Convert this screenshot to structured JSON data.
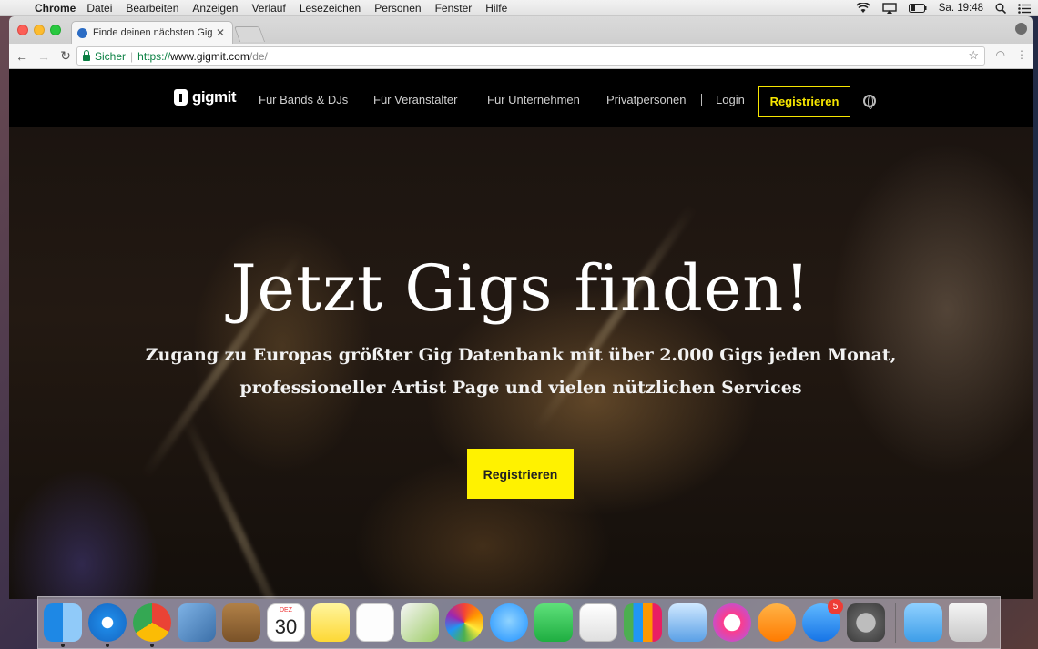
{
  "menubar": {
    "app": "Chrome",
    "items": [
      "Datei",
      "Bearbeiten",
      "Anzeigen",
      "Verlauf",
      "Lesezeichen",
      "Personen",
      "Fenster",
      "Hilfe"
    ],
    "clock": "Sa. 19:48"
  },
  "browser": {
    "tab_title": "Finde deinen nächsten Gig – gi",
    "security_label": "Sicher",
    "url_scheme": "https://",
    "url_host": "www.gigmit.com",
    "url_path": "/de/"
  },
  "site": {
    "logo": "gigmit",
    "nav": [
      "Für Bands & DJs",
      "Für Veranstalter",
      "Für Unternehmen",
      "Privatpersonen",
      "Login"
    ],
    "nav_register": "Registrieren",
    "accent_color": "#fff200"
  },
  "hero": {
    "title": "Jetzt Gigs finden!",
    "subtitle_line1": "Zugang zu Europas größter Gig Datenbank mit über 2.000 Gigs jeden Monat,",
    "subtitle_line2": "professioneller Artist Page und vielen nützlichen Services",
    "cta": "Registrieren"
  },
  "dock": {
    "calendar_month": "DEZ",
    "calendar_day": "30",
    "appstore_badge": "5"
  }
}
